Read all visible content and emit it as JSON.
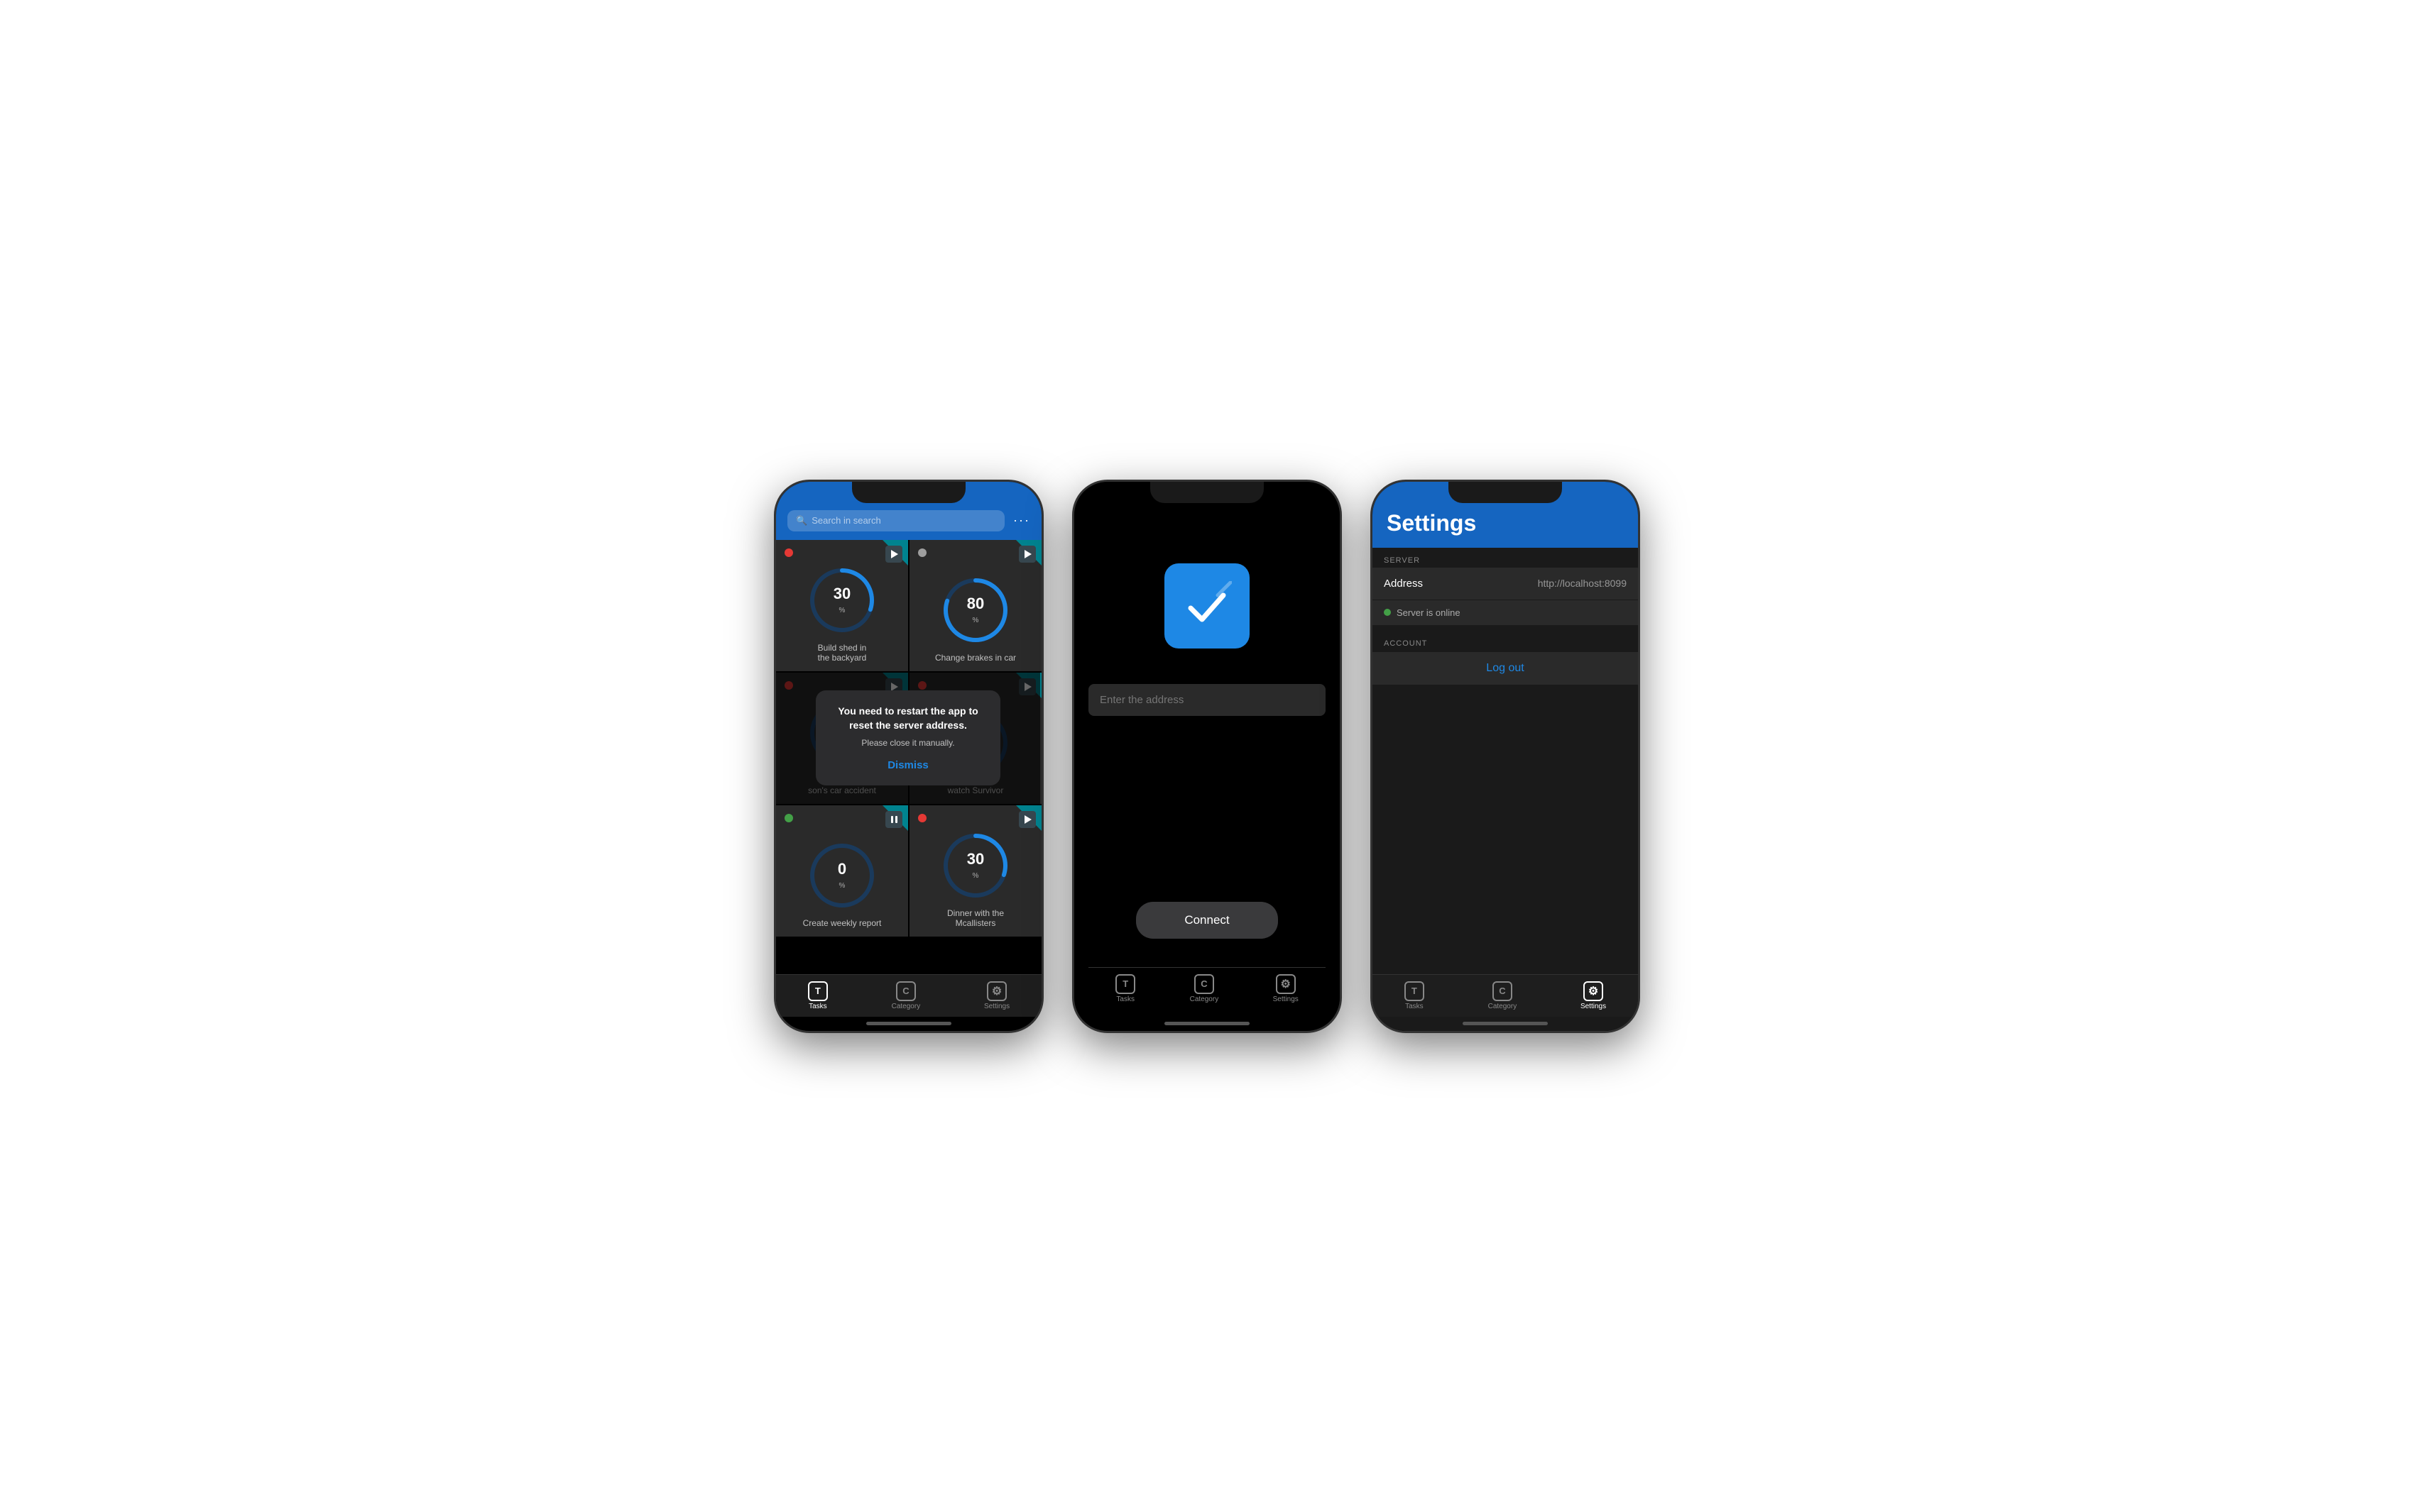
{
  "phone1": {
    "header": {
      "search_placeholder": "Search in search",
      "menu": "···"
    },
    "tasks": [
      {
        "id": "build-shed",
        "label": "Build shed in the backyard",
        "progress": 30,
        "dot_color": "red",
        "action": "play"
      },
      {
        "id": "change-brakes",
        "label": "Change brakes in car",
        "progress": 80,
        "dot_color": "gray",
        "action": "play"
      },
      {
        "id": "chiro-appointment",
        "label": "Chiro appointment son's car accident",
        "progress": 0,
        "dot_color": "red",
        "action": "play"
      },
      {
        "id": "watch-survivor",
        "label": "watch Survivor",
        "progress": 0,
        "dot_color": "red",
        "action": "play"
      },
      {
        "id": "create-weekly",
        "label": "Create weekly report",
        "progress": 0,
        "dot_color": "green",
        "action": "pause"
      },
      {
        "id": "dinner",
        "label": "Dinner with the Mcallisters",
        "progress": 30,
        "dot_color": "red",
        "action": "play"
      }
    ],
    "alert": {
      "title": "You need to restart the app to reset the server address.",
      "subtitle": "Please close it manually.",
      "dismiss_label": "Dismiss"
    },
    "tabs": [
      {
        "id": "tasks",
        "label": "Tasks",
        "icon": "T",
        "active": true
      },
      {
        "id": "category",
        "label": "Category",
        "icon": "C",
        "active": false
      },
      {
        "id": "settings",
        "label": "Settings",
        "icon": "⚙",
        "active": false
      }
    ]
  },
  "phone2": {
    "input_placeholder": "Enter the address",
    "connect_label": "Connect",
    "tabs": [
      {
        "id": "tasks",
        "label": "Tasks",
        "icon": "T",
        "active": false
      },
      {
        "id": "category",
        "label": "Category",
        "icon": "C",
        "active": false
      },
      {
        "id": "settings",
        "label": "Settings",
        "icon": "⚙",
        "active": false
      }
    ]
  },
  "phone3": {
    "header": {
      "title": "Settings"
    },
    "server_section": {
      "header": "SERVER",
      "address_label": "Address",
      "address_value": "http://localhost:8099",
      "status_text": "Server is online"
    },
    "account_section": {
      "header": "ACCOUNT",
      "logout_label": "Log out"
    },
    "tabs": [
      {
        "id": "tasks",
        "label": "Tasks",
        "icon": "T",
        "active": false
      },
      {
        "id": "category",
        "label": "Category",
        "icon": "C",
        "active": false
      },
      {
        "id": "settings",
        "label": "Settings",
        "icon": "⚙",
        "active": true
      }
    ]
  }
}
